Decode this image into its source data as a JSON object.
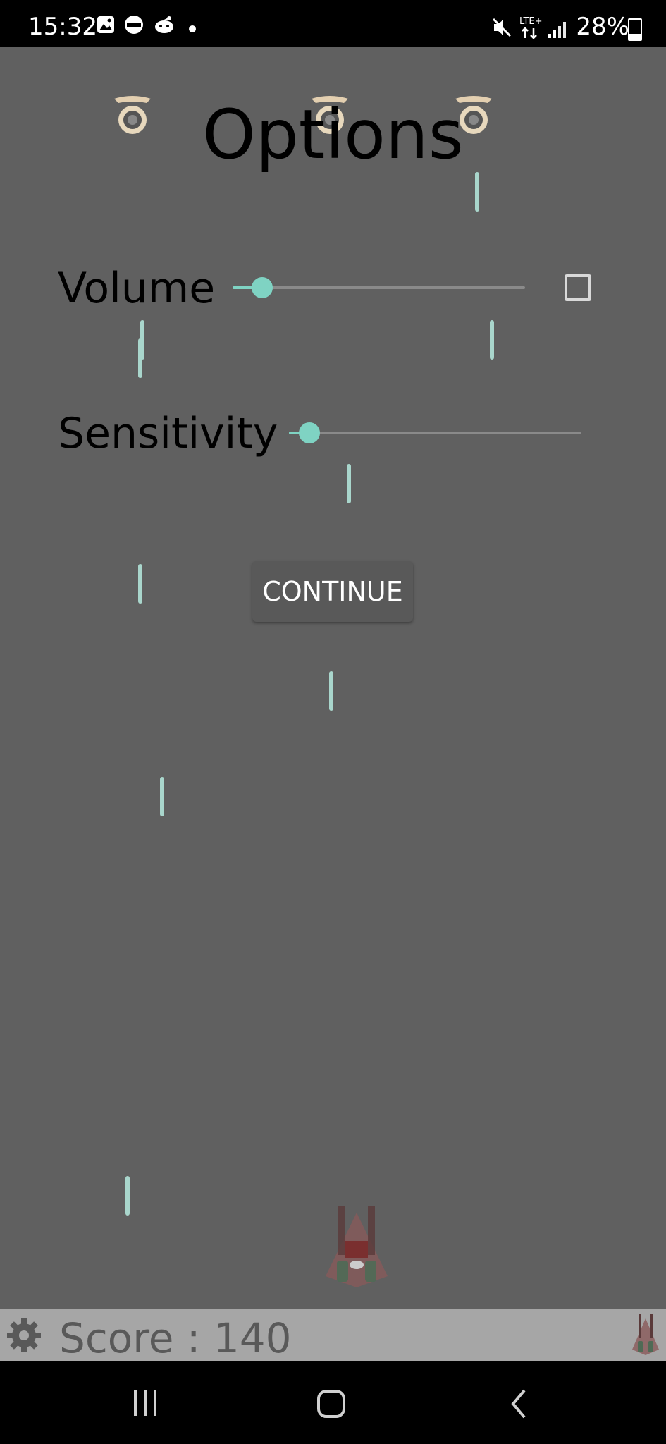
{
  "status_bar": {
    "time": "15:32",
    "battery_percent": "28%",
    "battery_level": 0.28,
    "notification_icons": [
      "gallery-icon",
      "wear-icon",
      "reddit-icon",
      "dot-icon"
    ],
    "system_icons": [
      "mute-icon",
      "lte-data-icon",
      "signal-icon",
      "battery-icon"
    ]
  },
  "options": {
    "title": "Options",
    "volume_label": "Volume",
    "volume_value": 0.1,
    "mute_checked": false,
    "sensitivity_label": "Sensitivity",
    "sensitivity_value": 0.07,
    "continue_label": "CONTINUE"
  },
  "score_bar": {
    "score_text": "Score : 140",
    "settings_icon": "gear-icon",
    "lives_icon": "player-ship-icon"
  },
  "nav_bar": {
    "items": [
      "recent-apps-icon",
      "home-icon",
      "back-icon"
    ]
  },
  "colors": {
    "background": "#606060",
    "accent": "#7fd3c3",
    "bullet": "#a9d6cc",
    "score_bar": "#a6a6a6"
  }
}
